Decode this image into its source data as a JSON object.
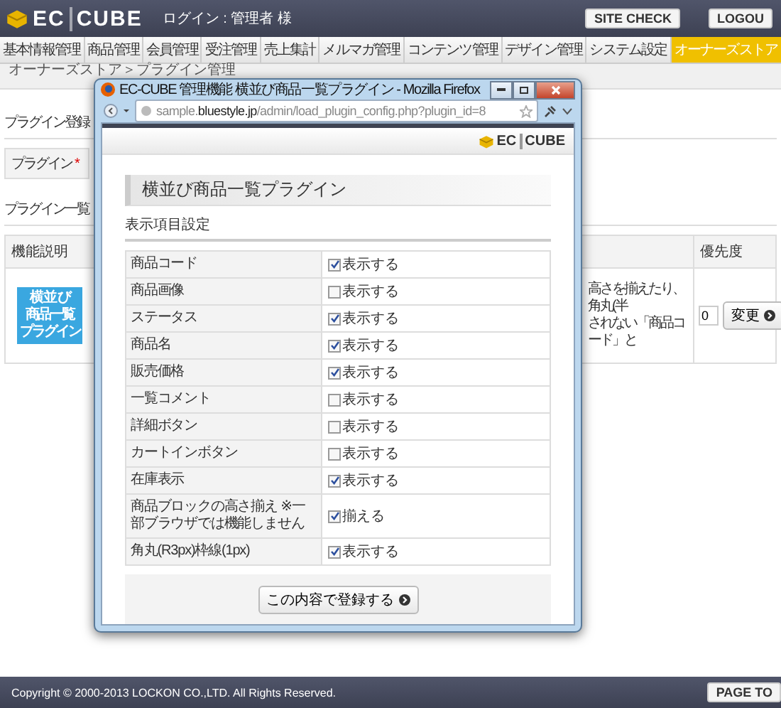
{
  "header": {
    "logo": [
      "EC",
      "CUBE"
    ],
    "login": "ログイン : 管理者 様",
    "buttons": [
      "SITE CHECK",
      "LOGOU"
    ]
  },
  "nav": [
    {
      "label": "基本情報管理",
      "selected": false
    },
    {
      "label": "商品管理",
      "selected": false
    },
    {
      "label": "会員管理",
      "selected": false
    },
    {
      "label": "受注管理",
      "selected": false
    },
    {
      "label": "売上集計",
      "selected": false
    },
    {
      "label": "メルマガ管理",
      "selected": false
    },
    {
      "label": "コンテンツ管理",
      "selected": false
    },
    {
      "label": "デザイン管理",
      "selected": false
    },
    {
      "label": "システム設定",
      "selected": false
    },
    {
      "label": "オーナーズストア",
      "selected": true
    }
  ],
  "breadcrumb": "オーナーズストア＞プラグイン管理",
  "register": {
    "title": "プラグイン登録",
    "field_label": "プラグイン",
    "required_mark": "*"
  },
  "plugin_list": {
    "title": "プラグイン一覧",
    "columns": [
      "機能説明",
      "優先度"
    ],
    "row": {
      "logo": [
        "横 並 び",
        "商品一覧",
        "プラグイン"
      ],
      "description": [
        "高さを揃えたり、角丸(半",
        "されない「商品コード」と"
      ],
      "priority": "0",
      "button": "変更"
    }
  },
  "popup": {
    "title": "EC-CUBE 管理機能 横並び商品一覧プラグイン - Mozilla Firefox",
    "url": "sample.**bluestyle.jp**/admin/load_plugin_config.php?plugin_id=8",
    "logo": [
      "EC",
      "CUBE"
    ],
    "heading": "横並び商品一覧プラグイン",
    "subheading": "表示項目設定",
    "rows": [
      {
        "label": "商品コード",
        "option": "表示する",
        "checked": true
      },
      {
        "label": "商品画像",
        "option": "表示する",
        "checked": false
      },
      {
        "label": "ステータス",
        "option": "表示する",
        "checked": true
      },
      {
        "label": "商品名",
        "option": "表示する",
        "checked": true
      },
      {
        "label": "販売価格",
        "option": "表示する",
        "checked": true
      },
      {
        "label": "一覧コメント",
        "option": "表示する",
        "checked": false
      },
      {
        "label": "詳細ボタン",
        "option": "表示する",
        "checked": false
      },
      {
        "label": "カートインボタン",
        "option": "表示する",
        "checked": false
      },
      {
        "label": "在庫表示",
        "option": "表示する",
        "checked": true
      },
      {
        "label": "商品ブロックの高さ揃え ※一部ブラウザでは機能しません",
        "option": "揃える",
        "checked": true
      },
      {
        "label": "角丸(R3px)枠線(1px)",
        "option": "表示する",
        "checked": true
      }
    ],
    "submit": "この内容で登録する"
  },
  "footer": {
    "copyright": "Copyright © 2000-2013 LOCKON CO.,LTD. All Rights Reserved.",
    "button": "PAGE TO"
  }
}
